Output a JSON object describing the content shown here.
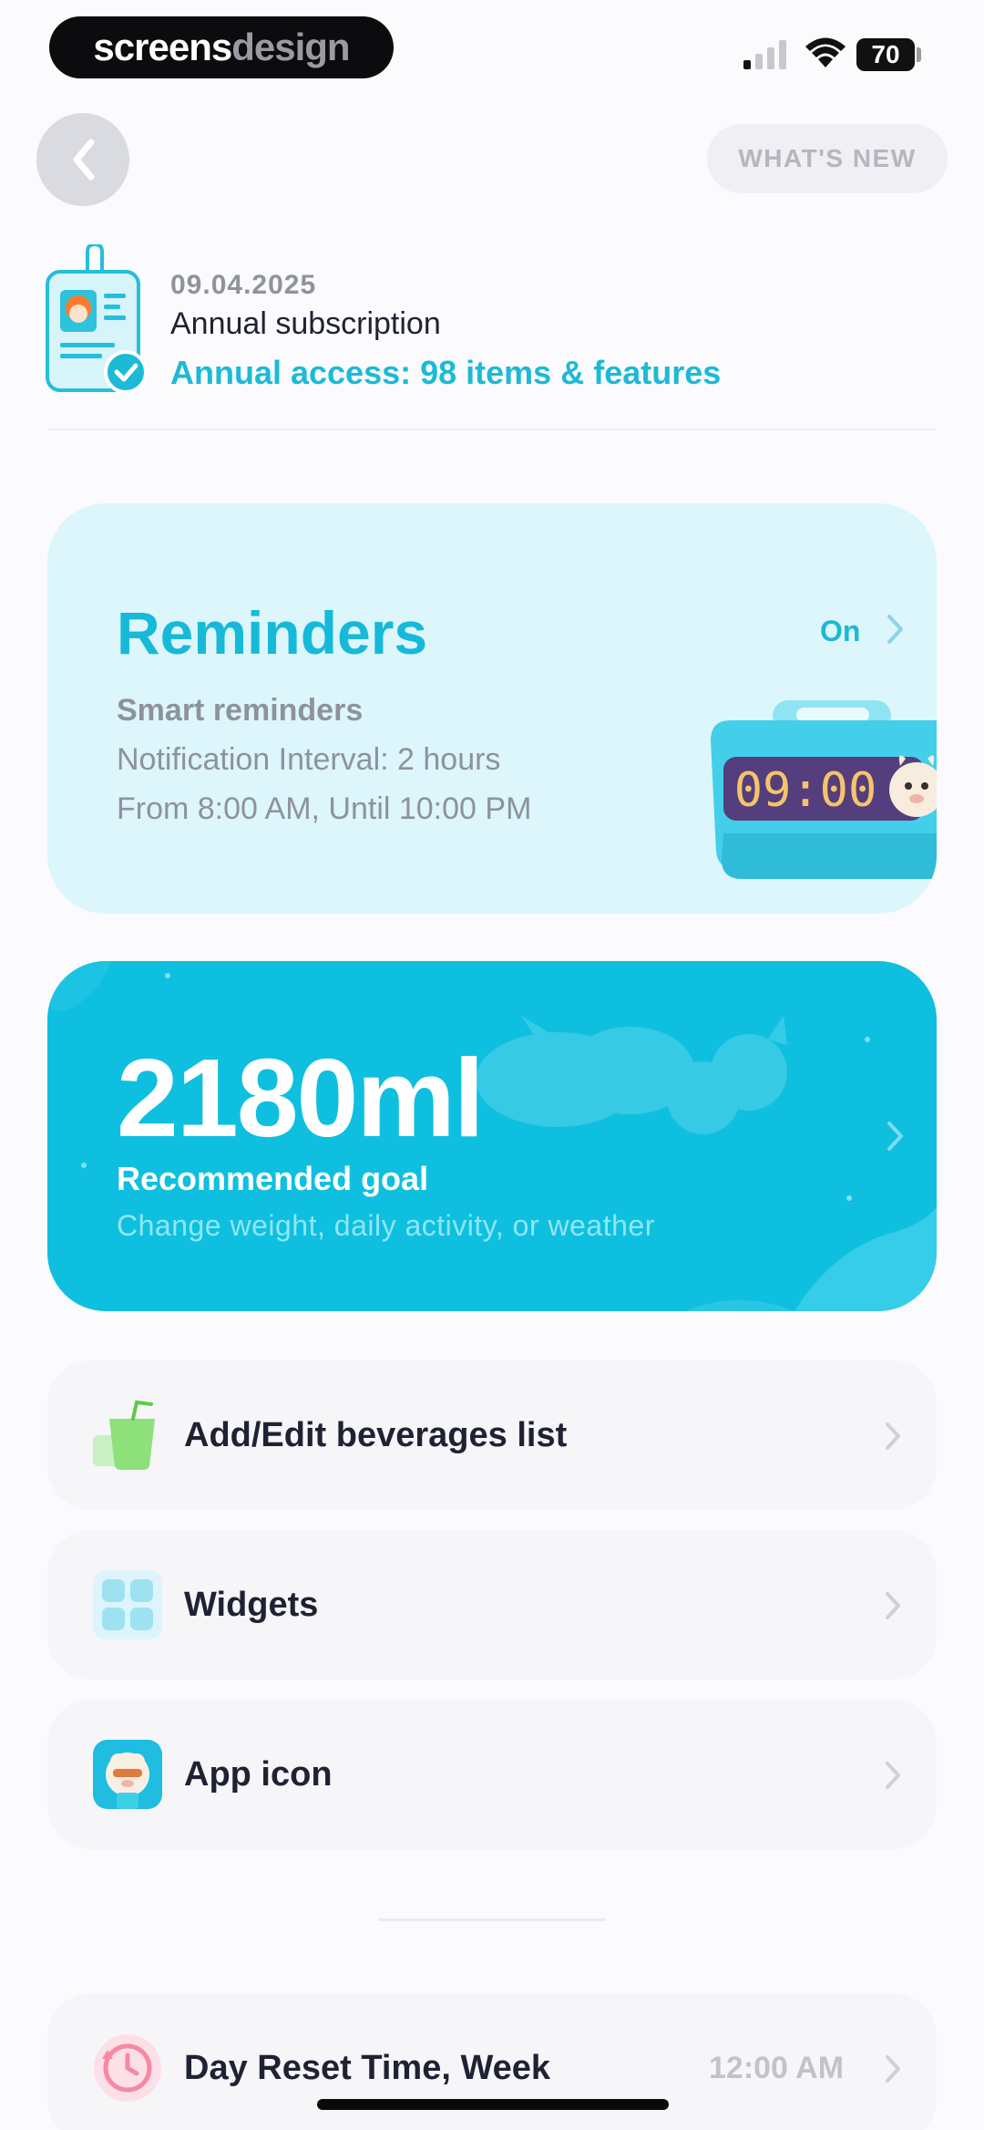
{
  "status_bar": {
    "brand_light": "screens",
    "brand_dark": "design",
    "battery": "70"
  },
  "nav": {
    "whats_new": "WHAT'S NEW"
  },
  "subscription": {
    "date": "09.04.2025",
    "title": "Annual subscription",
    "access": "Annual access: 98 items & features"
  },
  "reminders": {
    "title": "Reminders",
    "status": "On",
    "subtitle": "Smart reminders",
    "interval": "Notification Interval: 2 hours",
    "window": "From 8:00 AM, Until 10:00 PM",
    "clock_time": "09:00"
  },
  "goal": {
    "value": "2180ml",
    "label": "Recommended goal",
    "hint": "Change weight, daily activity, or weather"
  },
  "rows": [
    {
      "label": "Add/Edit beverages list",
      "icon": "beverage-cup-icon"
    },
    {
      "label": "Widgets",
      "icon": "widgets-grid-icon"
    },
    {
      "label": "App icon",
      "icon": "alpaca-app-icon"
    },
    {
      "label": "Day Reset Time, Week",
      "value": "12:00 AM",
      "icon": "reset-clock-icon"
    }
  ],
  "colors": {
    "accent": "#17b9d8",
    "reminders_bg": "#dcf6fc",
    "goal_bg": "#0fbfdf",
    "row_bg": "#f6f6f9",
    "text_primary": "#1f2233",
    "text_secondary": "#8e929d"
  }
}
